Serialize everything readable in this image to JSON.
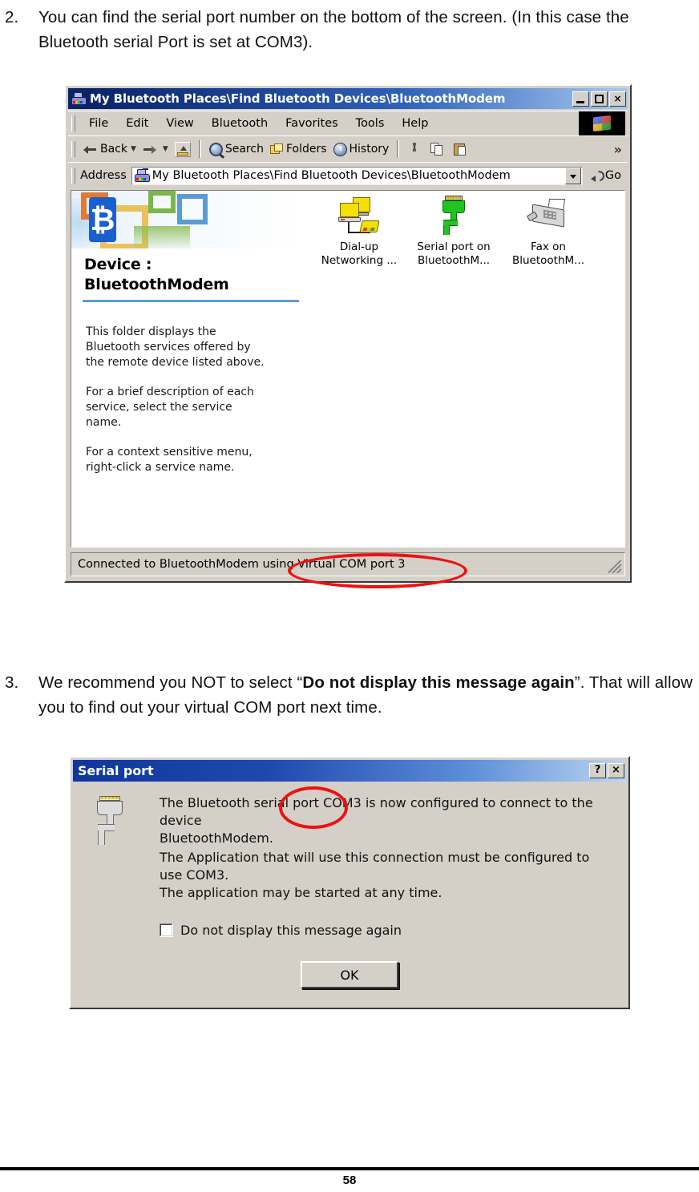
{
  "document": {
    "steps": [
      {
        "number": "2.",
        "text": "You can find the serial port number on the bottom of the screen. (In this case the Bluetooth serial Port is set at COM3)."
      },
      {
        "number": "3.",
        "text_before": "We recommend you NOT to select “",
        "text_bold": "Do not display this message again",
        "text_after": "”. That will allow you to find out your virtual COM port next time."
      }
    ],
    "page_number": "58"
  },
  "explorer_window": {
    "title": "My Bluetooth Places\\Find Bluetooth Devices\\BluetoothModem",
    "window_icon": "bluetooth-device-icon",
    "title_buttons": [
      {
        "name": "minimize-button",
        "label": ""
      },
      {
        "name": "maximize-button",
        "label": ""
      },
      {
        "name": "close-button",
        "label": "×"
      }
    ],
    "menu": [
      {
        "label": "File",
        "accel": "F"
      },
      {
        "label": "Edit",
        "accel": "E"
      },
      {
        "label": "View",
        "accel": "V"
      },
      {
        "label": "Bluetooth",
        "accel": "B"
      },
      {
        "label": "Favorites",
        "accel": "a"
      },
      {
        "label": "Tools",
        "accel": "T"
      },
      {
        "label": "Help",
        "accel": "H"
      }
    ],
    "toolbar": {
      "back_label": "Back",
      "forward_label": "",
      "up_label": "",
      "search_label": "Search",
      "folders_label": "Folders",
      "history_label": "History",
      "cut_label": "",
      "copy_label": "",
      "paste_label": "",
      "overflow_label": "»"
    },
    "address_bar": {
      "label": "Address",
      "value": "My Bluetooth Places\\Find Bluetooth Devices\\BluetoothModem",
      "go_label": "Go"
    },
    "left_panel": {
      "device_title_line1": "Device :",
      "device_title_line2": "BluetoothModem",
      "paragraphs": [
        "This folder displays the\nBluetooth services offered by\nthe remote device listed above.",
        "For a brief description of each\nservice, select the service\nname.",
        "For a context sensitive menu,\nright-click a service name."
      ]
    },
    "services": [
      {
        "icon": "dial-up-networking-icon",
        "label": "Dial-up\nNetworking ..."
      },
      {
        "icon": "serial-port-icon",
        "label": "Serial port on\nBluetoothM..."
      },
      {
        "icon": "fax-icon",
        "label": "Fax on\nBluetoothM..."
      }
    ],
    "status_bar": {
      "text": "Connected to BluetoothModem using Virtual COM port 3",
      "highlighted_phrase": "Virtual COM port 3"
    }
  },
  "serial_dialog": {
    "title": "Serial port",
    "help_button_label": "?",
    "close_button_label": "×",
    "icon": "serial-port-icon",
    "line1": "The Bluetooth serial port COM3 is now configured to connect to the device\nBluetoothModem.",
    "line2": "The Application that will use this connection must be configured to use COM3.",
    "line3": "The application may be started at any time.",
    "checkbox_label": "Do not display this message again",
    "checkbox_checked": false,
    "ok_label": "OK",
    "highlighted_phrase": "COM3"
  },
  "annotations": {
    "accent_color": "#ee1111",
    "ellipse_statusbar_target": "Virtual COM port 3",
    "ellipse_dialog_target": "COM3"
  }
}
